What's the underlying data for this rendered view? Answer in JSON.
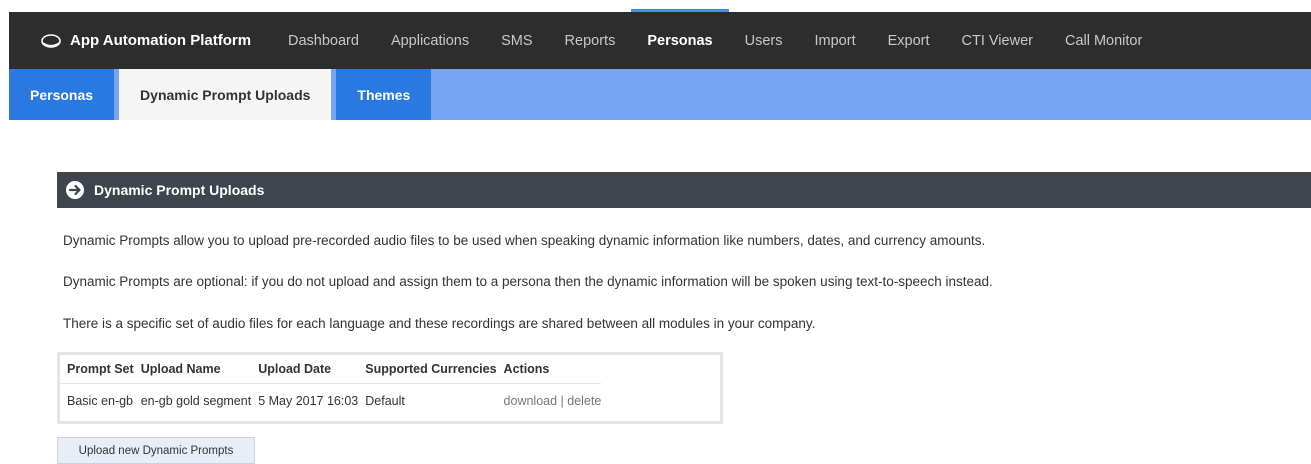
{
  "app": {
    "title": "App Automation Platform"
  },
  "nav": [
    {
      "label": "Dashboard",
      "active": false
    },
    {
      "label": "Applications",
      "active": false
    },
    {
      "label": "SMS",
      "active": false
    },
    {
      "label": "Reports",
      "active": false
    },
    {
      "label": "Personas",
      "active": true
    },
    {
      "label": "Users",
      "active": false
    },
    {
      "label": "Import",
      "active": false
    },
    {
      "label": "Export",
      "active": false
    },
    {
      "label": "CTI Viewer",
      "active": false
    },
    {
      "label": "Call Monitor",
      "active": false
    }
  ],
  "subtabs": [
    {
      "label": "Personas",
      "active": false
    },
    {
      "label": "Dynamic Prompt Uploads",
      "active": true
    },
    {
      "label": "Themes",
      "active": false
    }
  ],
  "panel": {
    "title": "Dynamic Prompt Uploads",
    "paragraphs": [
      "Dynamic Prompts allow you to upload pre-recorded audio files to be used when speaking dynamic information like numbers, dates, and currency amounts.",
      "Dynamic Prompts are optional: if you do not upload and assign them to a persona then the dynamic information will be spoken using text-to-speech instead.",
      "There is a specific set of audio files for each language and these recordings are shared between all modules in your company."
    ]
  },
  "table": {
    "headers": [
      "Prompt Set",
      "Upload Name",
      "Upload Date",
      "Supported Currencies",
      "Actions"
    ],
    "rows": [
      {
        "prompt_set": "Basic en-gb",
        "upload_name": "en-gb gold segment",
        "upload_date": "5 May 2017 16:03",
        "currencies": "Default",
        "download": "download",
        "separator": " | ",
        "delete": "delete"
      }
    ]
  },
  "upload_button": "Upload new Dynamic Prompts",
  "colors": {
    "topbar": "#2d2d2d",
    "subnav": "#76a6f3",
    "subtab": "#2a79e0",
    "panel_header": "#40454d",
    "accent": "#4a90e2"
  }
}
